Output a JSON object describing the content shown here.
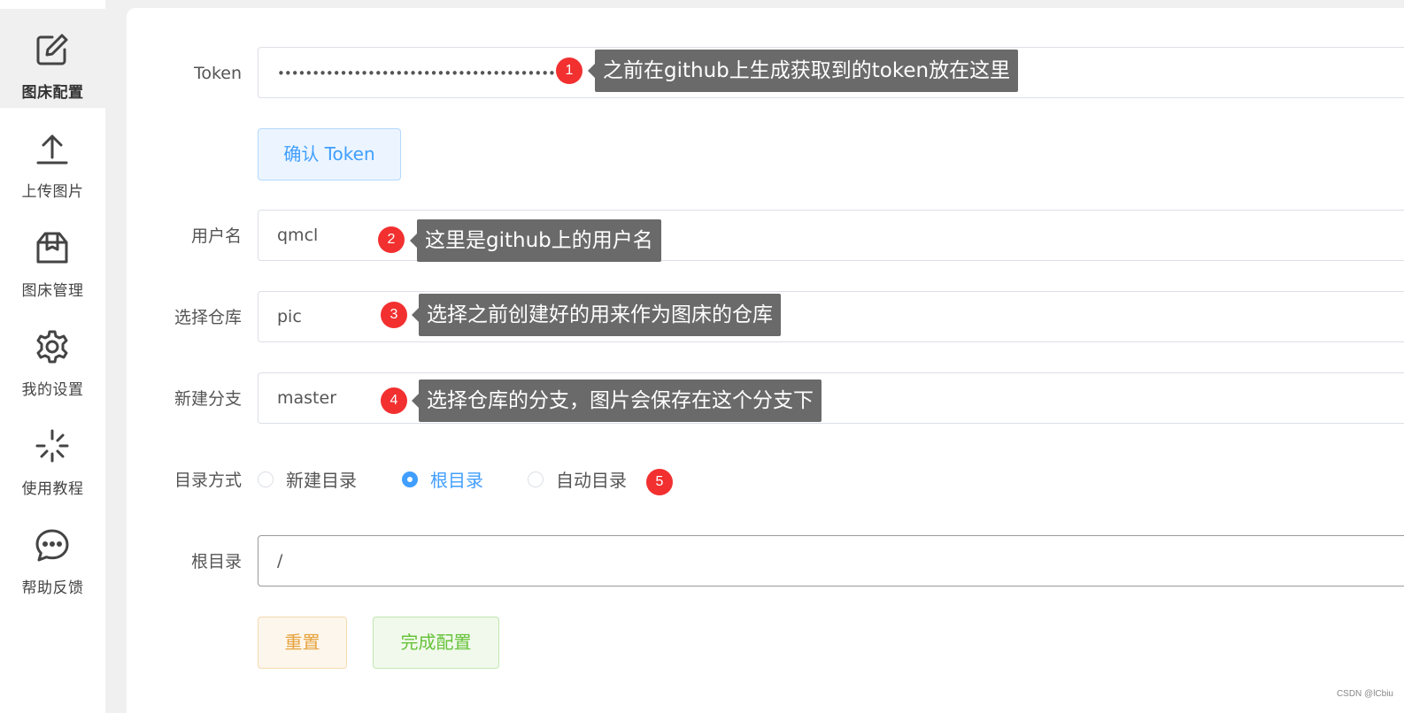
{
  "sidebar": {
    "items": [
      {
        "label": "图床配置",
        "icon": "edit-icon",
        "active": true
      },
      {
        "label": "上传图片",
        "icon": "upload-icon",
        "active": false
      },
      {
        "label": "图床管理",
        "icon": "box-icon",
        "active": false
      },
      {
        "label": "我的设置",
        "icon": "gear-icon",
        "active": false
      },
      {
        "label": "使用教程",
        "icon": "loading-icon",
        "active": false
      },
      {
        "label": "帮助反馈",
        "icon": "chat-icon",
        "active": false
      }
    ]
  },
  "form": {
    "token_label": "Token",
    "token_value": "••••••••••••••••••••••••••••••••••••••••",
    "confirm_token_button": "确认 Token",
    "username_label": "用户名",
    "username_value": "qmcl",
    "repo_label": "选择仓库",
    "repo_value": "pic",
    "branch_label": "新建分支",
    "branch_value": "master",
    "dir_mode_label": "目录方式",
    "dir_mode_options": [
      "新建目录",
      "根目录",
      "自动目录"
    ],
    "dir_mode_selected": "根目录",
    "root_dir_label": "根目录",
    "root_dir_value": "/",
    "reset_button": "重置",
    "finish_button": "完成配置"
  },
  "annotations": [
    {
      "number": "1",
      "text": "之前在github上生成获取到的token放在这里"
    },
    {
      "number": "2",
      "text": "这里是github上的用户名"
    },
    {
      "number": "3",
      "text": "选择之前创建好的用来作为图床的仓库"
    },
    {
      "number": "4",
      "text": "选择仓库的分支，图片会保存在这个分支下"
    },
    {
      "number": "5",
      "text": ""
    }
  ],
  "watermark": "CSDN @lCbiu",
  "colors": {
    "primary": "#409eff",
    "warning": "#e6a23c",
    "success": "#67c23a",
    "badge": "#f23030",
    "tooltip": "#6a6a6a"
  }
}
